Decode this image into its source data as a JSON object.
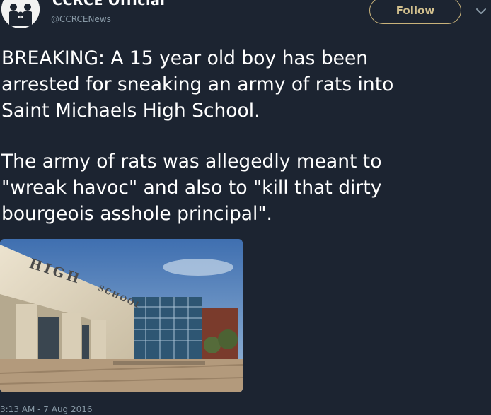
{
  "account": {
    "display_name": "CCRCE Official",
    "handle": "@CCRCENews",
    "avatar_icon": "family-silhouette-icon"
  },
  "header": {
    "follow_label": "Follow",
    "menu_icon": "chevron-down-icon"
  },
  "tweet": {
    "paragraphs": [
      "BREAKING: A 15 year old boy has been\narrested for sneaking an army of rats into\nSaint Michaels High School.",
      "The army of rats was allegedly meant to\n\"wreak havoc\" and also to \"kill that dirty\nbourgeois asshole principal\"."
    ],
    "timestamp": "3:13 AM - 7 Aug 2016"
  },
  "media": {
    "building_sign_words": [
      "HIGH",
      "SCHOOL"
    ]
  },
  "colors": {
    "background": "#1c2431",
    "text": "#ffffff",
    "secondary_text": "#8899a6",
    "follow_accent": "#c8b27a"
  }
}
